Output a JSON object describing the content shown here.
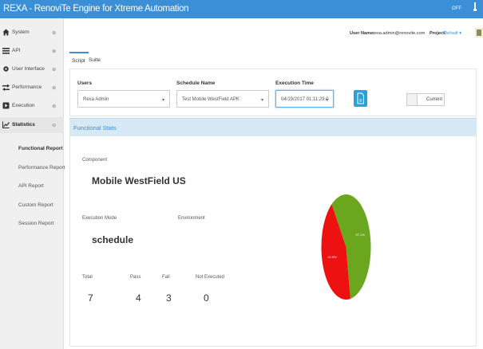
{
  "app": {
    "title": "REXA - RenoviTe Engine for Xtreme Automation",
    "status": "OFF"
  },
  "header": {
    "username_label": "User Name:",
    "username": "rexa.admin@renovite.com",
    "project_label": "Project:",
    "project": "Default"
  },
  "sidebar": {
    "items": [
      {
        "label": "System",
        "icon": "home-icon"
      },
      {
        "label": "API",
        "icon": "list-icon"
      },
      {
        "label": "User Interface",
        "icon": "gear-icon"
      },
      {
        "label": "Performance",
        "icon": "shuffle-icon"
      },
      {
        "label": "Execution",
        "icon": "play-icon"
      },
      {
        "label": "Statistics",
        "icon": "chart-icon"
      }
    ],
    "sub_items": [
      "Functional Report",
      "Performance Report",
      "API Report",
      "Custom Report",
      "Session Report"
    ]
  },
  "tabs": [
    "Script",
    "Suite"
  ],
  "filters": {
    "users_label": "Users",
    "users_value": "Rexa Admin",
    "schedule_label": "Schedule Name",
    "schedule_value": "Test Mobile WestField APK",
    "exec_label": "Execution Time",
    "exec_value": "04/19/2017 01:11:29.0",
    "current_label": "Current"
  },
  "stats": {
    "header": "Functional Stats",
    "component_label": "Component",
    "component_value": "Mobile WestField US",
    "mode_label": "Execution Mode",
    "mode_value": "schedule",
    "environment_label": "Environment",
    "environment_value": "",
    "total_label": "Total",
    "total": "7",
    "pass_label": "Pass",
    "pass": "4",
    "fail_label": "Fail",
    "fail": "3",
    "not_label": "Not Executed",
    "not": "0"
  },
  "chart_data": {
    "type": "pie",
    "values": [
      {
        "label": "Pass",
        "value": 57.1,
        "color": "#6aa61e",
        "text": "57.1%"
      },
      {
        "label": "Fail",
        "value": 42.9,
        "color": "#ee1111",
        "text": "42.9%"
      }
    ]
  },
  "colors": {
    "accent": "#3a8fd6",
    "pass": "#6aa61e",
    "fail": "#ee1111"
  }
}
